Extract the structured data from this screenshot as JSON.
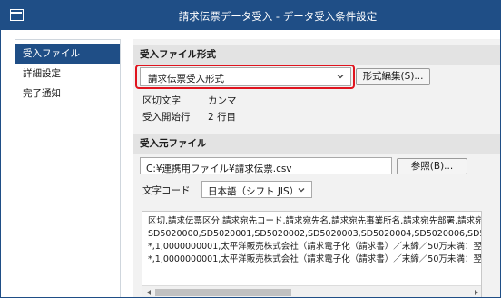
{
  "window": {
    "title": "請求伝票データ受入 - データ受入条件設定",
    "accent": "#1f4e86",
    "highlight": "#e0141e"
  },
  "sidebar": {
    "items": [
      {
        "label": "受入ファイル",
        "active": true
      },
      {
        "label": "詳細設定",
        "active": false
      },
      {
        "label": "完了通知",
        "active": false
      }
    ]
  },
  "format_section": {
    "header": "受入ファイル形式",
    "format_select": "請求伝票受入形式",
    "edit_button": "形式編集(S)...",
    "delimiter_label": "区切文字",
    "delimiter_value": "カンマ",
    "start_row_label": "受入開始行",
    "start_row_value": "2 行目"
  },
  "source_section": {
    "header": "受入元ファイル",
    "file_path": "C:¥連携用ファイル¥請求伝票.csv",
    "browse_button": "参照(B)...",
    "encoding_label": "文字コード",
    "encoding_value": "日本語（シフト JIS）"
  },
  "preview": {
    "lines": [
      "区切,請求伝票区分,請求宛先コード,請求宛先名,請求宛先事業所名,請求宛先部署,請求宛",
      "SD5020000,SD5020001,SD5020002,SD5020003,SD5020004,SD5020006,SD50",
      "*,1,0000000001,太平洋販売株式会社（請求電子化（請求書）／末締／50万未満：翌",
      "*,1,0000000001,太平洋販売株式会社（請求電子化（請求書）／末締／50万未満：翌"
    ]
  }
}
